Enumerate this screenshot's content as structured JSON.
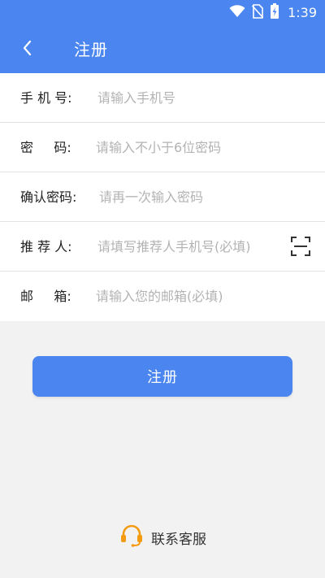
{
  "status_bar": {
    "time": "1:39",
    "icons": [
      "wifi-icon",
      "no-sim-icon",
      "battery-charging-icon"
    ]
  },
  "header": {
    "back_icon": "chevron-left-icon",
    "title": "注册"
  },
  "form": {
    "fields": [
      {
        "label": "手 机 号:",
        "placeholder": "请输入手机号"
      },
      {
        "label": "密     码:",
        "placeholder": "请输入不小于6位密码"
      },
      {
        "label": "确认密码:",
        "placeholder": "请再一次输入密码"
      },
      {
        "label": "推 荐 人:",
        "placeholder": "请填写推荐人手机号(必填)"
      },
      {
        "label": "邮     箱:",
        "placeholder": "请输入您的邮箱(必填)"
      }
    ],
    "scan_icon": "scan-icon"
  },
  "register_button": {
    "label": "注册"
  },
  "contact": {
    "icon": "headset-icon",
    "label": "联系客服"
  },
  "colors": {
    "primary": "#4b86f0",
    "background": "#f2f2f2",
    "accent_orange": "#f39c12"
  }
}
